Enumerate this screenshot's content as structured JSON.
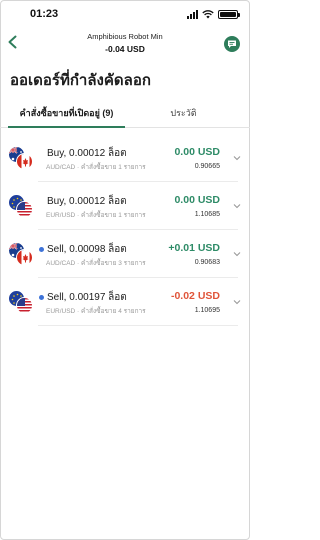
{
  "status": {
    "time": "01:23"
  },
  "header": {
    "name": "Amphibious Robot Min",
    "pl": "-0.04 USD"
  },
  "page_title": "ออเดอร์ที่กำลังคัดลอก",
  "tabs": [
    {
      "label": "คำสั่งซื้อขายที่เปิดอยู่ (9)"
    },
    {
      "label": "ประวัติ"
    }
  ],
  "colors": {
    "accent": "#2e7d5b",
    "positive": "#2e8b67",
    "negative": "#e0553a",
    "dot": "#3e73d8"
  },
  "orders": [
    {
      "flags": [
        "australia-flag",
        "canada-flag"
      ],
      "trade": "Buy, 0.00012 ล็อต",
      "sub": "AUD/CAD · คำสั่งซื้อขาย 1 รายการ",
      "pl": "0.00 USD",
      "pl_color": "#2e8b67",
      "price": "0.90665",
      "dot": false
    },
    {
      "flags": [
        "eu-flag",
        "us-flag"
      ],
      "trade": "Buy, 0.00012 ล็อต",
      "sub": "EUR/USD · คำสั่งซื้อขาย 1 รายการ",
      "pl": "0.00 USD",
      "pl_color": "#2e8b67",
      "price": "1.10685",
      "dot": false
    },
    {
      "flags": [
        "australia-flag",
        "canada-flag"
      ],
      "trade": "Sell, 0.00098 ล็อต",
      "sub": "AUD/CAD · คำสั่งซื้อขาย 3 รายการ",
      "pl": "+0.01 USD",
      "pl_color": "#2e8b67",
      "price": "0.90683",
      "dot": true
    },
    {
      "flags": [
        "eu-flag",
        "us-flag"
      ],
      "trade": "Sell, 0.00197 ล็อต",
      "sub": "EUR/USD · คำสั่งซื้อขาย 4 รายการ",
      "pl": "-0.02 USD",
      "pl_color": "#e0553a",
      "price": "1.10695",
      "dot": true
    }
  ]
}
